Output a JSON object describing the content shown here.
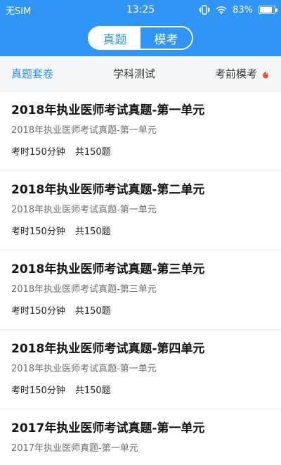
{
  "status_bar": {
    "carrier": "无SIM",
    "time": "13:25",
    "battery_percent_text": "83%",
    "battery_level": 0.83,
    "icons": [
      "vibrate-icon",
      "wifi-icon",
      "battery-icon"
    ]
  },
  "header": {
    "toggle": {
      "left_label": "真题",
      "right_label": "模考",
      "selected": "right"
    }
  },
  "subtabs": [
    {
      "label": "真题套卷",
      "selected": true
    },
    {
      "label": "学科测试",
      "selected": false
    },
    {
      "label": "考前模考",
      "selected": false,
      "icon": "fire-icon"
    }
  ],
  "list": {
    "items": [
      {
        "title": "2018年执业医师考试真题-第一单元",
        "subtitle": "2018年执业医师考试真题-第一单元",
        "time": "考时150分钟",
        "count": "共150题"
      },
      {
        "title": "2018年执业医师考试真题-第二单元",
        "subtitle": "2018年执业医师考试真题-第一单元",
        "time": "考时150分钟",
        "count": "共150题"
      },
      {
        "title": "2018年执业医师考试真题-第三单元",
        "subtitle": "2018年执业医师考试真题-第三单元",
        "time": "考时150分钟",
        "count": "共150题"
      },
      {
        "title": "2018年执业医师考试真题-第四单元",
        "subtitle": "2018年执业医师考试真题-第一单元",
        "time": "考时150分钟",
        "count": "共150题"
      },
      {
        "title": "2017年执业医师考试真题-第一单元",
        "subtitle": "2017年执业医师真题-第一单元",
        "time": "",
        "count": ""
      }
    ]
  },
  "colors": {
    "accent": "#2F95F6",
    "fire": "#F24A2B"
  }
}
